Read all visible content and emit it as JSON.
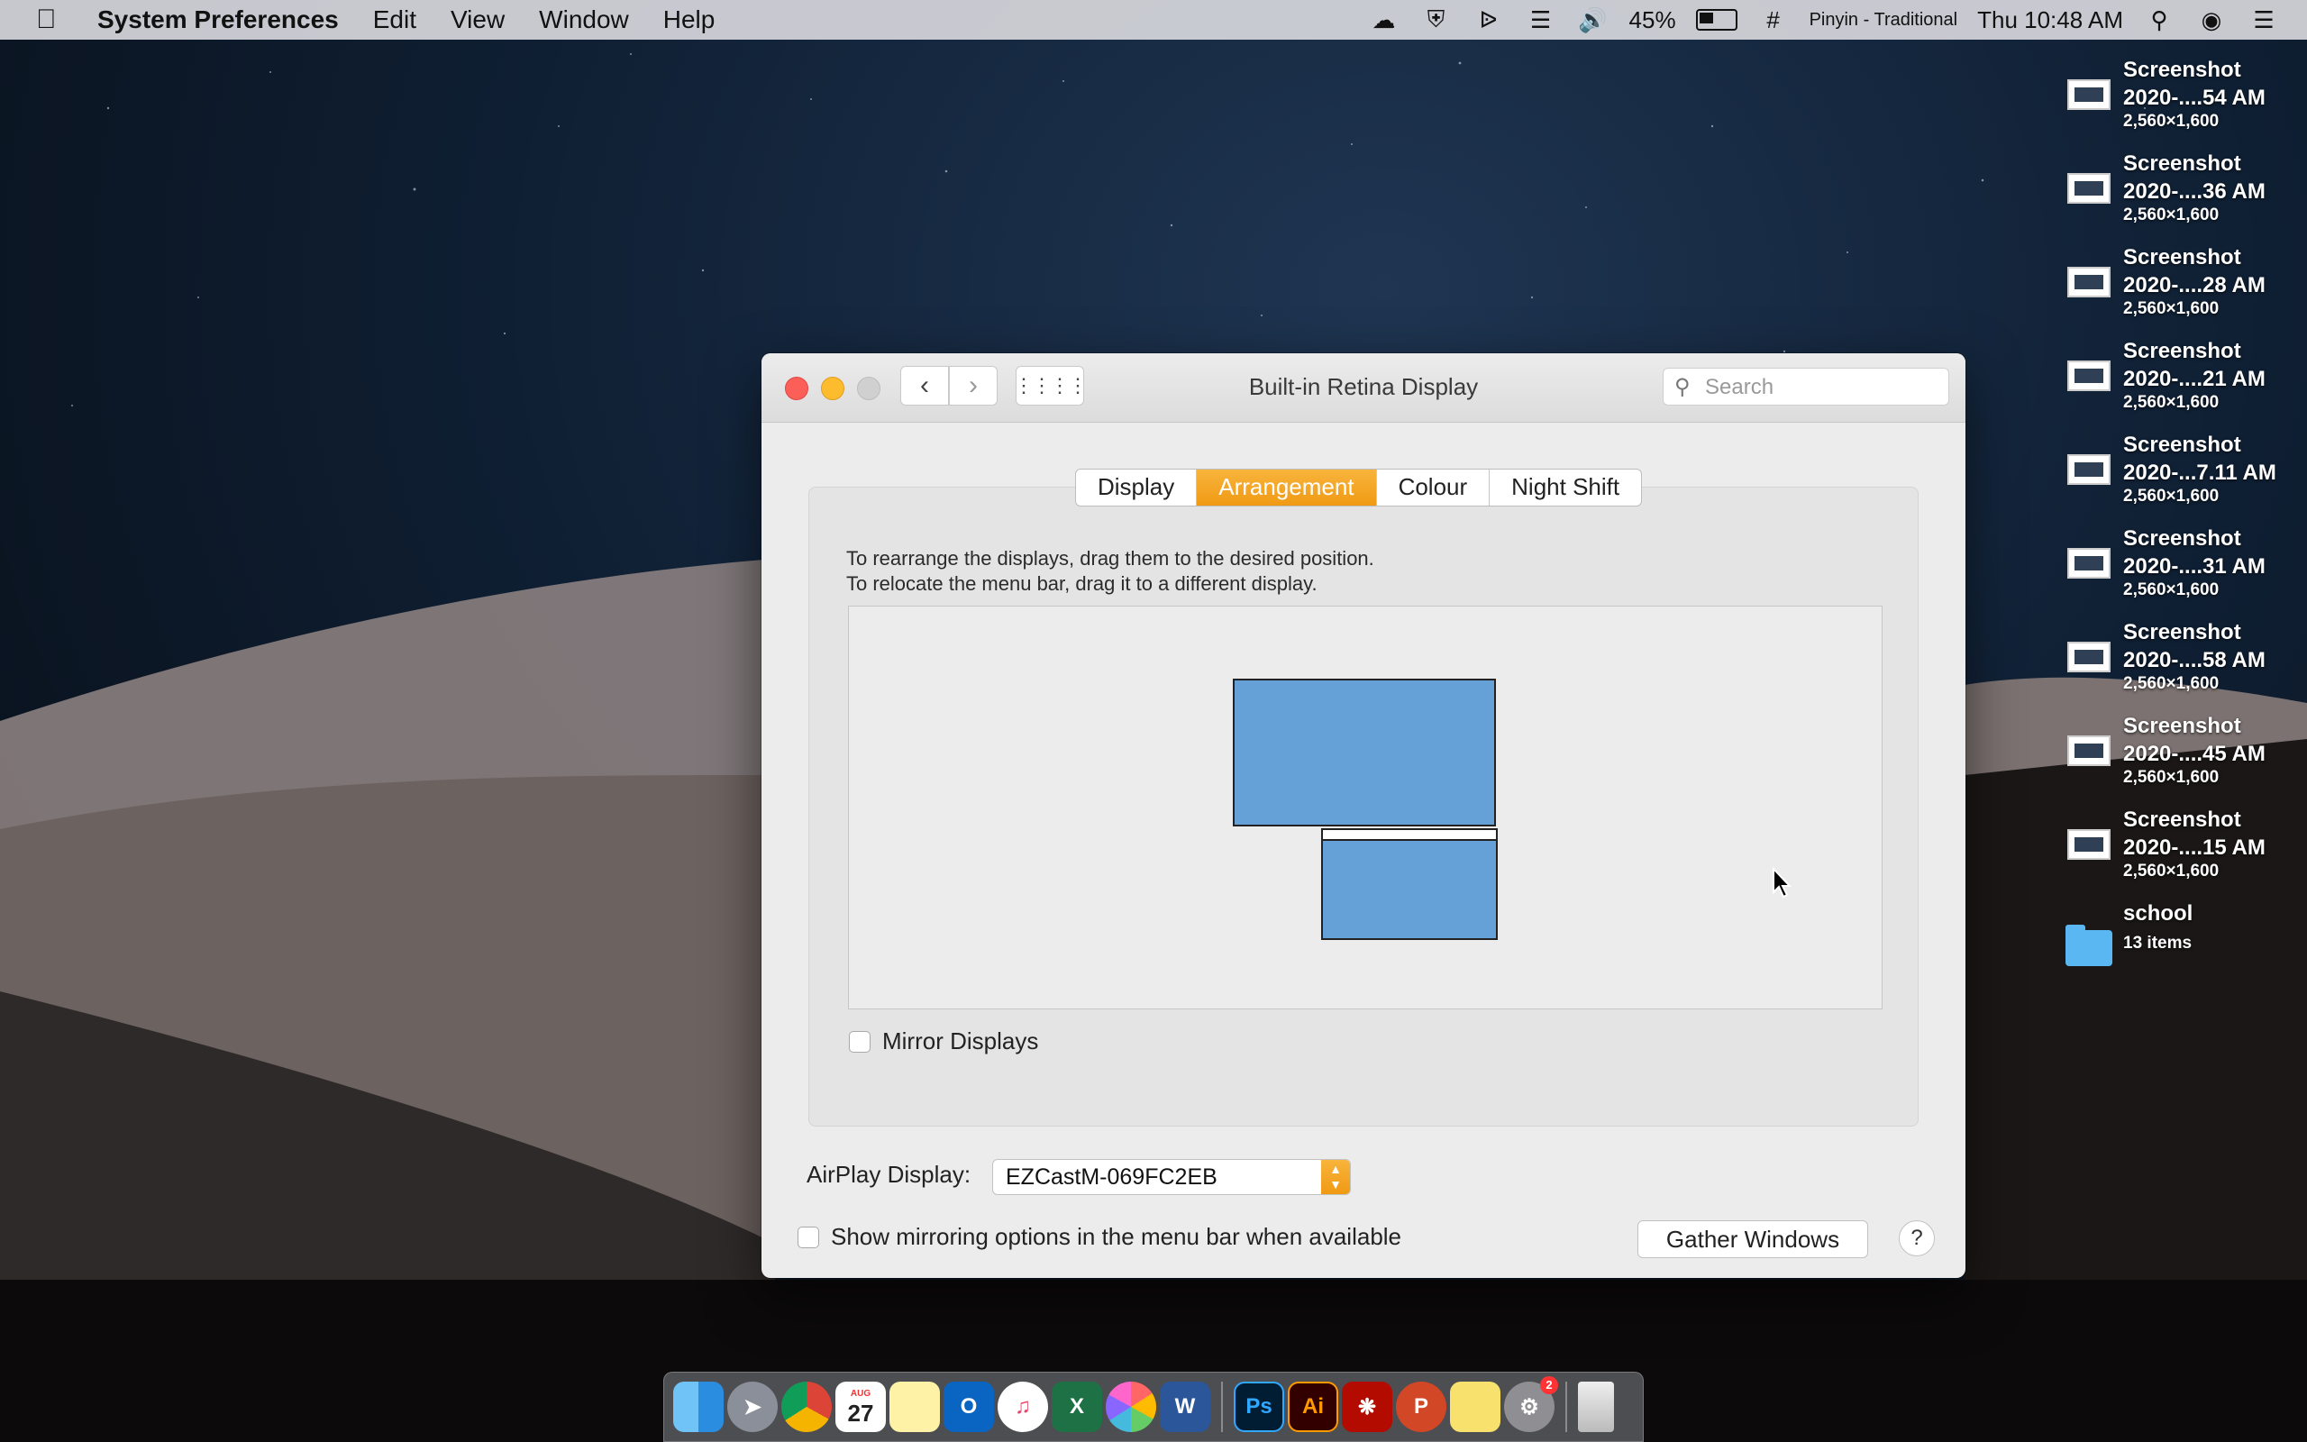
{
  "menubar": {
    "app_name": "System Preferences",
    "menus": [
      "Edit",
      "View",
      "Window",
      "Help"
    ],
    "battery_percent": "45%",
    "input_source": "Pinyin - Traditional",
    "clock": "Thu 10:48 AM",
    "battery_level": 0.45
  },
  "desktop": {
    "items": [
      {
        "name1": "Screenshot",
        "name2": "2020-....54 AM",
        "sub": "2,560×1,600"
      },
      {
        "name1": "Screenshot",
        "name2": "2020-....36 AM",
        "sub": "2,560×1,600"
      },
      {
        "name1": "Screenshot",
        "name2": "2020-....28 AM",
        "sub": "2,560×1,600"
      },
      {
        "name1": "Screenshot",
        "name2": "2020-....21 AM",
        "sub": "2,560×1,600"
      },
      {
        "name1": "Screenshot",
        "name2": "2020-...7.11 AM",
        "sub": "2,560×1,600"
      },
      {
        "name1": "Screenshot",
        "name2": "2020-....31 AM",
        "sub": "2,560×1,600"
      },
      {
        "name1": "Screenshot",
        "name2": "2020-....58 AM",
        "sub": "2,560×1,600"
      },
      {
        "name1": "Screenshot",
        "name2": "2020-....45 AM",
        "sub": "2,560×1,600"
      },
      {
        "name1": "Screenshot",
        "name2": "2020-....15 AM",
        "sub": "2,560×1,600"
      }
    ],
    "folder": {
      "name": "school",
      "sub": "13 items"
    }
  },
  "window": {
    "title": "Built-in Retina Display",
    "search_placeholder": "Search",
    "tabs": [
      "Display",
      "Arrangement",
      "Colour",
      "Night Shift"
    ],
    "active_tab": "Arrangement",
    "instructions": {
      "line1": "To rearrange the displays, drag them to the desired position.",
      "line2": "To relocate the menu bar, drag it to a different display."
    },
    "mirror_label": "Mirror Displays",
    "airplay_label": "AirPlay Display:",
    "airplay_value": "EZCastM-069FC2EB",
    "show_mirroring_label": "Show mirroring options in the menu bar when available",
    "gather_label": "Gather Windows",
    "help_label": "?"
  },
  "dock": {
    "calendar_month": "AUG",
    "calendar_day": "27",
    "sysprefs_badge": "2",
    "apps": [
      "Finder",
      "Launchpad",
      "Chrome",
      "Calendar",
      "Notes",
      "Outlook",
      "iTunes",
      "Excel",
      "Photos",
      "Word",
      "Photoshop",
      "Illustrator",
      "Acrobat",
      "PowerPoint",
      "Stickies",
      "System Preferences",
      "Trash"
    ]
  },
  "colors": {
    "accent": "#f5a623",
    "display_blue": "#65a0d7"
  }
}
